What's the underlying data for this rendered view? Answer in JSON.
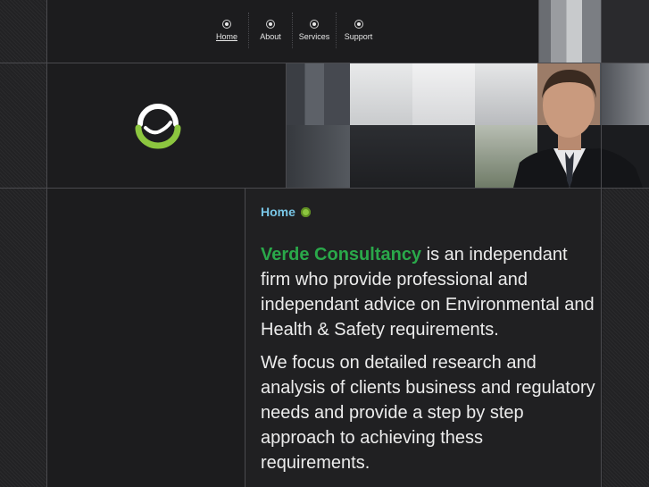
{
  "nav": {
    "items": [
      {
        "label": "Home",
        "active": true
      },
      {
        "label": "About",
        "active": false
      },
      {
        "label": "Services",
        "active": false
      },
      {
        "label": "Support",
        "active": false
      }
    ]
  },
  "logo": {
    "icon": "recycle-swirl-logo",
    "colors": {
      "ring": "#ffffff",
      "arc": "#8cc63f"
    }
  },
  "breadcrumb": {
    "label": "Home",
    "icon": "green-dot-icon"
  },
  "content": {
    "brand_name": "Verde Consultancy",
    "intro_rest": " is an independant firm who provide professional and independant advice on Environmental and Health & Safety requirements.",
    "paragraph2": "We focus on detailed research and analysis  of clients business and regulatory needs and provide a step by step approach to achieving thess requirements."
  },
  "colors": {
    "background": "#1e1e20",
    "grid_line": "#4a4a4e",
    "brand_green": "#2aa84a",
    "link_blue": "#79c6e6",
    "text": "#ececec"
  }
}
